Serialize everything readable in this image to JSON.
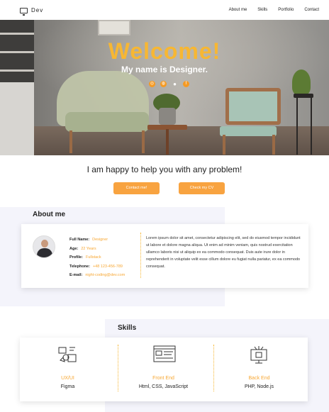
{
  "nav": {
    "logo_text": "Dev",
    "links": [
      "About me",
      "Skills",
      "Portfolio",
      "Contact"
    ]
  },
  "hero": {
    "title": "Welcome!",
    "subtitle": "My name is Designer.",
    "socials": [
      "instagram-icon",
      "dribbble-icon",
      "github-icon",
      "facebook-icon"
    ]
  },
  "help": {
    "text": "I am happy to help you with any problem!",
    "contact_button": "Contact me!",
    "cv_button": "Check my CV"
  },
  "about": {
    "title": "About me",
    "fields": [
      {
        "key": "Full Name:",
        "value": "Designer"
      },
      {
        "key": "Age:",
        "value": "22 Years"
      },
      {
        "key": "Profile:",
        "value": "Fullstack"
      },
      {
        "key": "Telephone:",
        "value": "+48 123-456-789"
      },
      {
        "key": "E-mail:",
        "value": "night-coding@dev.com"
      }
    ],
    "text": "Lorem ipsum dolor sit amet, consectetur adipiscing elit, sed do eiusmod tempor incididunt ut labore et dolore magna aliqua. Ut enim ad minim veniam, quis nostrud exercitation ullamco laboris nisi ut aliquip ex ea commodo consequat. Duis aute irure dolor in reprehenderit in voluptate velit esse cillum dolore eu fugiat nulla pariatur, ex ea commodo consequat."
  },
  "skills": {
    "title": "Skills",
    "items": [
      {
        "name": "UX/UI",
        "desc": "Figma",
        "icon": "ux-design-icon"
      },
      {
        "name": "Front End",
        "desc": "Html, CSS, JavaScript",
        "icon": "frontend-code-icon"
      },
      {
        "name": "Back End",
        "desc": "PHP, Node.js",
        "icon": "server-monitor-icon"
      }
    ]
  },
  "colors": {
    "accent": "#f7b733",
    "button": "#f8a340",
    "section_bg": "#f4f4fb"
  }
}
